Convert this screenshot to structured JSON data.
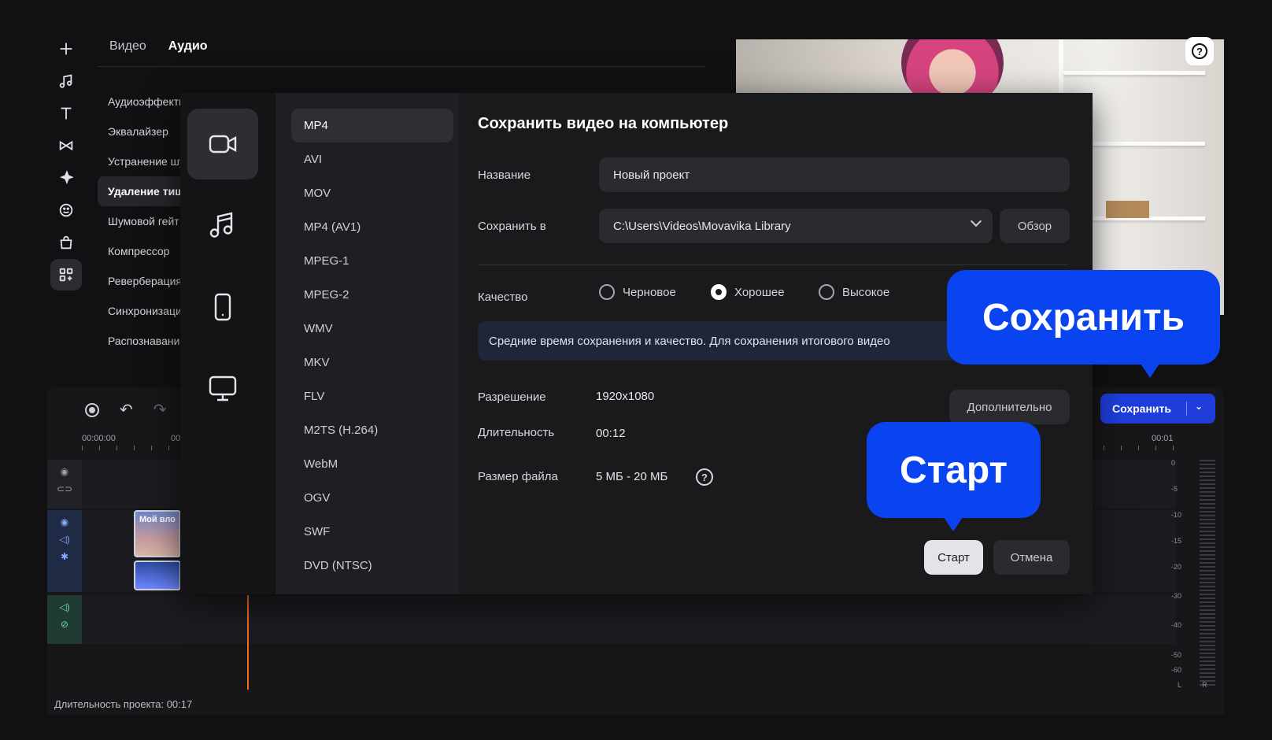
{
  "editor": {
    "tabs": [
      {
        "label": "Видео",
        "active": false
      },
      {
        "label": "Аудио",
        "active": true
      }
    ],
    "effects": [
      "Аудиоэффекты",
      "Эквалайзер",
      "Устранение шума",
      "Удаление тишины",
      "Шумовой гейт",
      "Компрессор",
      "Реверберация",
      "Синхронизация",
      "Распознавание"
    ],
    "active_effect_index": 3,
    "tool_icons": [
      "plus-icon",
      "music-note-icon",
      "text-icon",
      "transitions-icon",
      "sparkle-icon",
      "sticker-icon",
      "shopping-bag-icon",
      "more-tools-icon"
    ],
    "help_icon": "question-icon",
    "save_button_label": "Сохранить",
    "timeline": {
      "ruler_start": "00:00:00",
      "ruler_partial": "00",
      "ruler_end": "00:01",
      "clip_title": "Мой вло",
      "project_duration": "Длительность проекта: 00:17",
      "meter_labels": [
        "0",
        "-5",
        "-10",
        "-15",
        "-20",
        "-30",
        "-40",
        "-50",
        "-60"
      ],
      "meter_channels": "L R"
    }
  },
  "dialog": {
    "title": "Сохранить видео на компьютер",
    "categories": [
      "video-camera-icon",
      "music-note-icon",
      "phone-icon",
      "monitor-icon"
    ],
    "formats": [
      "MP4",
      "AVI",
      "MOV",
      "MP4 (AV1)",
      "MPEG-1",
      "MPEG-2",
      "WMV",
      "MKV",
      "FLV",
      "M2TS (H.264)",
      "WebM",
      "OGV",
      "SWF",
      "DVD (NTSC)"
    ],
    "selected_format": "MP4",
    "name_label": "Название",
    "name_value": "Новый проект",
    "save_to_label": "Сохранить в",
    "save_to_value": "C:\\Users\\Videos\\Movavika Library",
    "browse_label": "Обзор",
    "quality_label": "Качество",
    "quality_options": [
      {
        "label": "Черновое",
        "selected": false
      },
      {
        "label": "Хорошее",
        "selected": true
      },
      {
        "label": "Высокое",
        "selected": false
      }
    ],
    "info_text": "Средние время сохранения и качество. Для сохранения итогового видео",
    "resolution_label": "Разрешение",
    "resolution_value": "1920x1080",
    "advanced_label": "Дополнительно",
    "duration_label": "Длительность",
    "duration_value": "00:12",
    "filesize_label": "Размер файла",
    "filesize_value": "5 МБ - 20 МБ",
    "start_label": "Старт",
    "cancel_label": "Отмена"
  },
  "callouts": {
    "save": "Сохранить",
    "start": "Старт"
  },
  "colors": {
    "accent": "#1e3ddb",
    "callout": "#0a43f0",
    "playhead": "#f26b1d"
  }
}
